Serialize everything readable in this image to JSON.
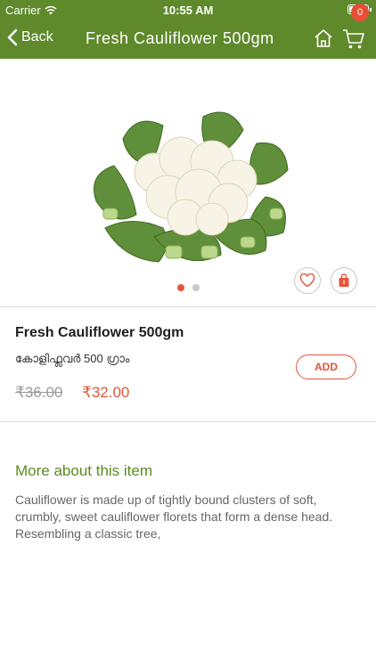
{
  "status_bar": {
    "carrier": "Carrier",
    "time": "10:55 AM"
  },
  "nav": {
    "back_label": "Back",
    "title": "Fresh Cauliflower 500gm",
    "cart_count": "0",
    "icons": [
      "chevron-left-icon",
      "home-icon",
      "cart-icon"
    ]
  },
  "gallery": {
    "image_subject": "cauliflower",
    "page_count": 2,
    "active_page": 1,
    "actions": [
      "heart-icon",
      "bag-icon"
    ]
  },
  "product": {
    "name": "Fresh Cauliflower 500gm",
    "local_name": "കോളിഫ്ലവർ 500 ഗ്രാം",
    "old_price": "₹36.00",
    "new_price": "₹32.00",
    "add_label": "ADD"
  },
  "about": {
    "title": "More about this item",
    "description": "Cauliflower is made up of tightly bound clusters of soft, crumbly, sweet cauliflower florets that form a dense head. Resembling a classic tree,"
  },
  "colors": {
    "brand_green": "#5f8a2c",
    "accent_orange": "#e2553a",
    "section_green": "#5a8a1e"
  }
}
